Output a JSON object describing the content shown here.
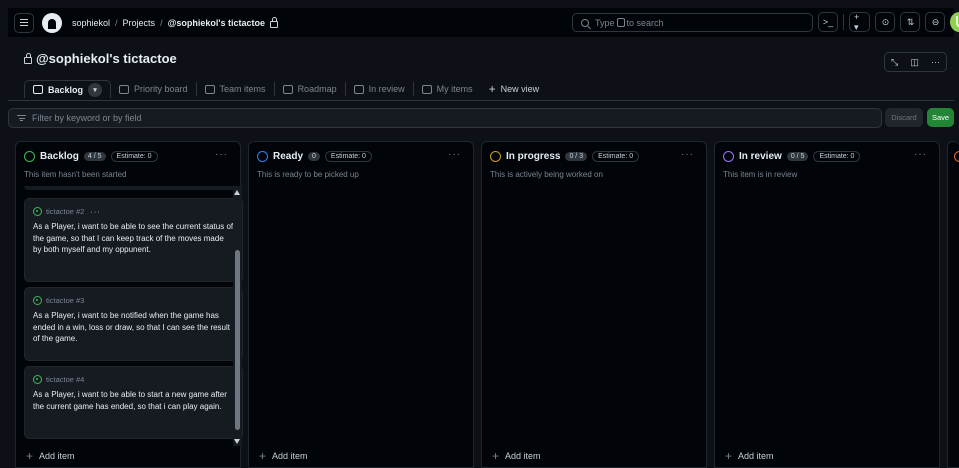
{
  "header": {
    "breadcrumb": {
      "user": "sophiekol",
      "sep1": "/",
      "projects": "Projects",
      "sep2": "/",
      "project": "@sophiekol's tictactoe"
    },
    "search_placeholder_pre": "Type",
    "search_placeholder_post": "to search",
    "terminal_label": ">_",
    "plus_label": "+ ▾",
    "issues_icon": "issue-opened-icon",
    "pr_label": "⇅",
    "inbox_icon": "inbox-icon"
  },
  "project": {
    "title": "@sophiekol's tictactoe",
    "actions": {
      "insights": "⤡",
      "layout": "◫",
      "more": "···"
    }
  },
  "tabs": [
    {
      "label": "Backlog",
      "icon": "board-icon"
    },
    {
      "label": "Priority board",
      "icon": "board-icon"
    },
    {
      "label": "Team items",
      "icon": "table-icon"
    },
    {
      "label": "Roadmap",
      "icon": "roadmap-icon"
    },
    {
      "label": "In review",
      "icon": "table-icon"
    },
    {
      "label": "My items",
      "icon": "table-icon"
    },
    {
      "label": "New view",
      "icon": "plus-icon"
    }
  ],
  "filter": {
    "placeholder": "Filter by keyword or by field",
    "discard": "Discard",
    "save": "Save"
  },
  "columns": [
    {
      "name": "Backlog",
      "count": "4 / 5",
      "estimate": "Estimate: 0",
      "description": "This item hasn't been started",
      "color": "#3fb950",
      "add": "Add item"
    },
    {
      "name": "Ready",
      "count": "0",
      "estimate": "Estimate: 0",
      "description": "This is ready to be picked up",
      "color": "#2f81f7",
      "add": "Add item"
    },
    {
      "name": "In progress",
      "count": "0 / 3",
      "estimate": "Estimate: 0",
      "description": "This is actively being worked on",
      "color": "#d29922",
      "add": "Add item"
    },
    {
      "name": "In review",
      "count": "0 / 5",
      "estimate": "Estimate: 0",
      "description": "This item is in review",
      "color": "#a371f7",
      "add": "Add item"
    }
  ],
  "cards": [
    {
      "ref": "tictactoe #2",
      "more": "···",
      "title": "As a Player, i want to be able to see the current status of the game, so that I can keep track of the moves made by both myself and my oppunent."
    },
    {
      "ref": "tictactoe #3",
      "title": "As a Player, i want to be notified when the game has ended in a win, loss or draw, so that I can see the result of the game."
    },
    {
      "ref": "tictactoe #4",
      "title": "As a Player, i want to be able to start a new game after the current game has ended, so that i can play again."
    }
  ],
  "colors": {
    "bg": "#0d1117",
    "green": "#238636",
    "blue": "#2f81f7",
    "orange": "#d29922",
    "purple": "#a371f7"
  }
}
